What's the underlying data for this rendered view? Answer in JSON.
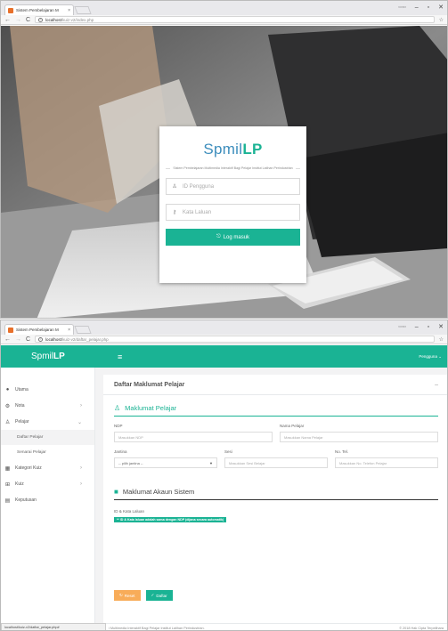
{
  "colors": {
    "brand": "#1ab394",
    "logo_blue": "#3c8dbc",
    "warning": "#f8ac59"
  },
  "login_window": {
    "tab_title": "Sistem Pembelajaran M",
    "url_host": "localhost",
    "url_path": "/kuiz-v2/index.php",
    "logo": {
      "part1": "Spmil",
      "part2": "LP"
    },
    "tagline": "Sistem Pembelajaran Multimedia Interaktif Bagi Pelajar Institut Latihan Perindustrian",
    "username_placeholder": "ID Pengguna",
    "password_placeholder": "Kata Laluan",
    "login_button": "Log masuk"
  },
  "admin_window": {
    "tab_title": "Sistem Pembelajaran M",
    "url_host": "localhost",
    "url_path": "/kuiz-v2/daftar_pelajar.php",
    "brand": {
      "part1": "Spmil",
      "part2": "LP"
    },
    "user_menu": "Pengguna",
    "sidebar": {
      "utama": "Utama",
      "nota": "Nota",
      "pelajar": "Pelajar",
      "daftar_pelajar": "Daftar Pelajar",
      "senarai_pelajar": "Senarai Pelajar",
      "kategori_kuiz": "Kategori Kuiz",
      "kuiz": "Kuiz",
      "keputusan": "Keputusan"
    },
    "panel_title": "Daftar Maklumat Pelajar",
    "section_student": "Maklumat Pelajar",
    "fields": {
      "ndp_label": "NDP",
      "ndp_placeholder": "Masukkan NDP",
      "nama_label": "Nama Pelajar",
      "nama_placeholder": "Masukkan Nama Pelajar",
      "jantina_label": "Jantina",
      "jantina_value": "-- pilih jantina --",
      "sesi_label": "Sesi",
      "sesi_placeholder": "Masukkan Sesi Belajar",
      "notel_label": "No. Tel.",
      "notel_placeholder": "Masukkan No. Telefon Pelajar"
    },
    "section_account": "Maklumat Akaun Sistem",
    "cred_label": "ID & Kata Laluan",
    "cred_note": "** ID & Kata laluan adalah sama dengan NDP (dijana secara automatik)",
    "reset_button": "Reset",
    "save_button": "Daftar",
    "footer_left": "i Multimedia Interaktif Bagi Pelajar Institut Latihan Perindustrian.",
    "footer_right": "© 2018 Hak Cipta Terpelihara",
    "status_url": "localhost/kuiz-v2/daftar_pelajar.php#"
  }
}
